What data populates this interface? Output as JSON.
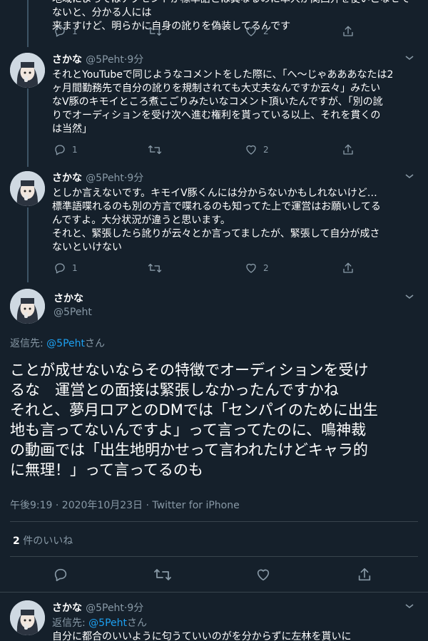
{
  "top_partial": {
    "line1": "地域によってはアクセントが標準語とは異なるのに本人が関西弁を使いこなせてないと、分かる人には",
    "line2": "来ますけど、明らかに自身の訛りを偽装してるんです",
    "reply_count": "1",
    "like_count": "2"
  },
  "tweet1": {
    "author": "さかな",
    "handle": "@5Peht",
    "time": "9分",
    "lines": [
      "それとYouTubeで同じようなコメントをした際に、「へ〜じゃあああなたは2",
      "ヶ月間勤務先で自分の訛りを規制されても大丈夫なんですか云々」みたい",
      "なV豚のキモイところ煮こごりみたいなコメント頂いたんですが、「別の訛",
      "りでオーディションを受け次へ進む権利を貰っている以上、それを貫くの",
      "は当然」"
    ],
    "reply_count": "1",
    "like_count": "2"
  },
  "tweet2": {
    "author": "さかな",
    "handle": "@5Peht",
    "time": "9分",
    "lines": [
      "としか言えないです。キモイV豚くんには分からないかもしれないけど…",
      "標準語喋れるのも別の方言で喋れるのも知ってた上で運営はお願いしてる",
      "んですよ。大分状況が違うと思います。",
      "それと、緊張したら訛りが云々とか言ってましたが、緊張して自分が成さ",
      "ないといけない"
    ],
    "reply_count": "1",
    "like_count": "2"
  },
  "main_tweet": {
    "author": "さかな",
    "handle": "@5Peht",
    "reply_prefix": "返信先: ",
    "reply_to": "@5Peht",
    "reply_suffix": "さん",
    "lines": [
      "ことが成せないならその特徴でオーディションを受け",
      "るな　運営との面接は緊張しなかったんですかね",
      "それと、夢月ロアとのDMでは「センパイのために出生",
      "地も言ってないんですよ」って言ってたのに、鳴神裁",
      "の動画では「出生地明かせって言われたけどキャラ的",
      "に無理！」って言ってるのも"
    ],
    "timestamp": "午後9:19 · 2020年10月23日 · Twitter for iPhone",
    "likes_count": "2",
    "likes_label": " 件のいいね"
  },
  "tweet3": {
    "author": "さかな",
    "handle": "@5Peht",
    "time": "9分",
    "reply_prefix": "返信先: ",
    "reply_to": "@5Peht",
    "reply_suffix": "さん",
    "partial": "自分に都合のいいように匂うていいのがを分からずに左林を貰いに"
  },
  "colors": {
    "background": "#15202b",
    "text": "#ffffff",
    "muted": "#8899a6",
    "link": "#1da1f2",
    "divider": "#38444d"
  }
}
